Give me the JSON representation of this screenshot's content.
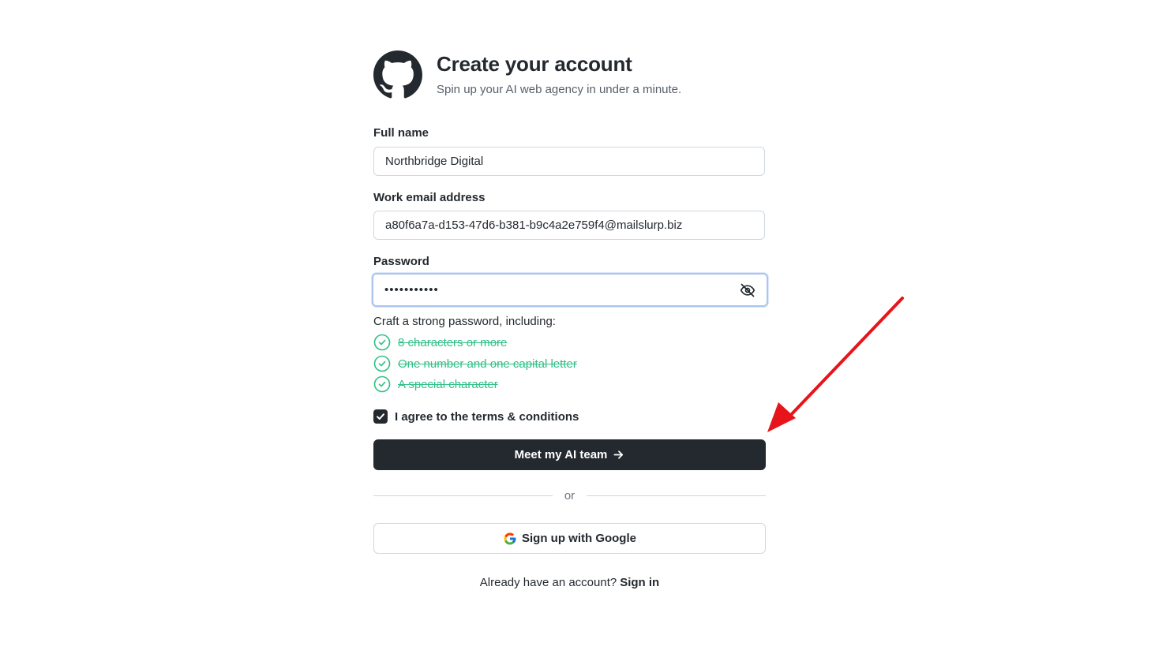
{
  "header": {
    "logo_icon": "github-logo-icon",
    "title": "Create your account",
    "subtitle": "Spin up your AI web agency in under a minute."
  },
  "form": {
    "full_name": {
      "label": "Full name",
      "value": "Northbridge Digital"
    },
    "email": {
      "label": "Work email address",
      "value": "a80f6a7a-d153-47d6-b381-b9c4a2e759f4@mailslurp.biz"
    },
    "password": {
      "label": "Password",
      "masked_value": "•••••••••••",
      "visibility_icon": "eye-off-icon"
    },
    "password_hint": {
      "title": "Craft a strong password, including:",
      "rules": [
        {
          "text": "8 characters or more",
          "satisfied": true
        },
        {
          "text": "One number and one capital letter",
          "satisfied": true
        },
        {
          "text": "A special character",
          "satisfied": true
        }
      ],
      "satisfied_color": "#2fbf85"
    },
    "terms": {
      "label": "I agree to the terms & conditions",
      "checked": true
    },
    "submit": {
      "label": "Meet my AI team",
      "icon": "arrow-right-icon",
      "background": "#24292f"
    },
    "divider_text": "or",
    "google": {
      "label": "Sign up with Google",
      "icon": "google-icon"
    },
    "signin": {
      "prompt": "Already have an account?",
      "link": "Sign in"
    }
  },
  "annotation": {
    "type": "arrow",
    "color": "#e8141c"
  }
}
